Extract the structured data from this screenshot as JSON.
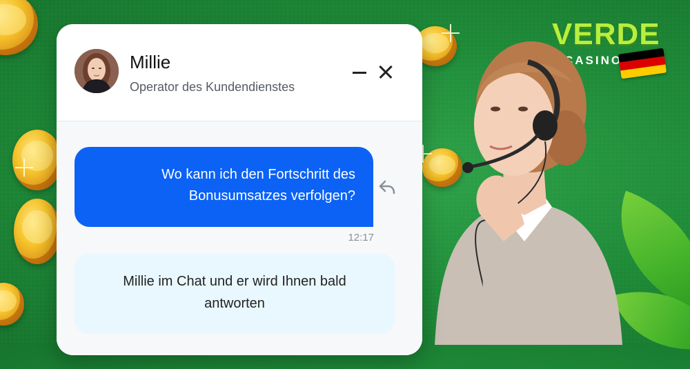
{
  "brand": {
    "name": "VERDE",
    "subtitle": "CASINO",
    "flag_colors": [
      "#000000",
      "#dd0000",
      "#ffcc00"
    ],
    "accent": "#b6ef3d"
  },
  "chat": {
    "operator": {
      "name": "Millie",
      "role": "Operator des Kundendienstes"
    },
    "controls": {
      "minimize_icon": "minimize-icon",
      "close_icon": "close-icon"
    },
    "messages": [
      {
        "from": "user",
        "text": "Wo kann ich den Fortschritt des Bonusumsatzes verfolgen?",
        "time": "12:17",
        "color": "#0b62f5"
      },
      {
        "from": "operator",
        "text": "Millie im Chat und er wird Ihnen bald antworten",
        "color": "#e9f8fe"
      }
    ]
  },
  "colors": {
    "background": "#1e8a38",
    "coin": "#f5c22a"
  }
}
